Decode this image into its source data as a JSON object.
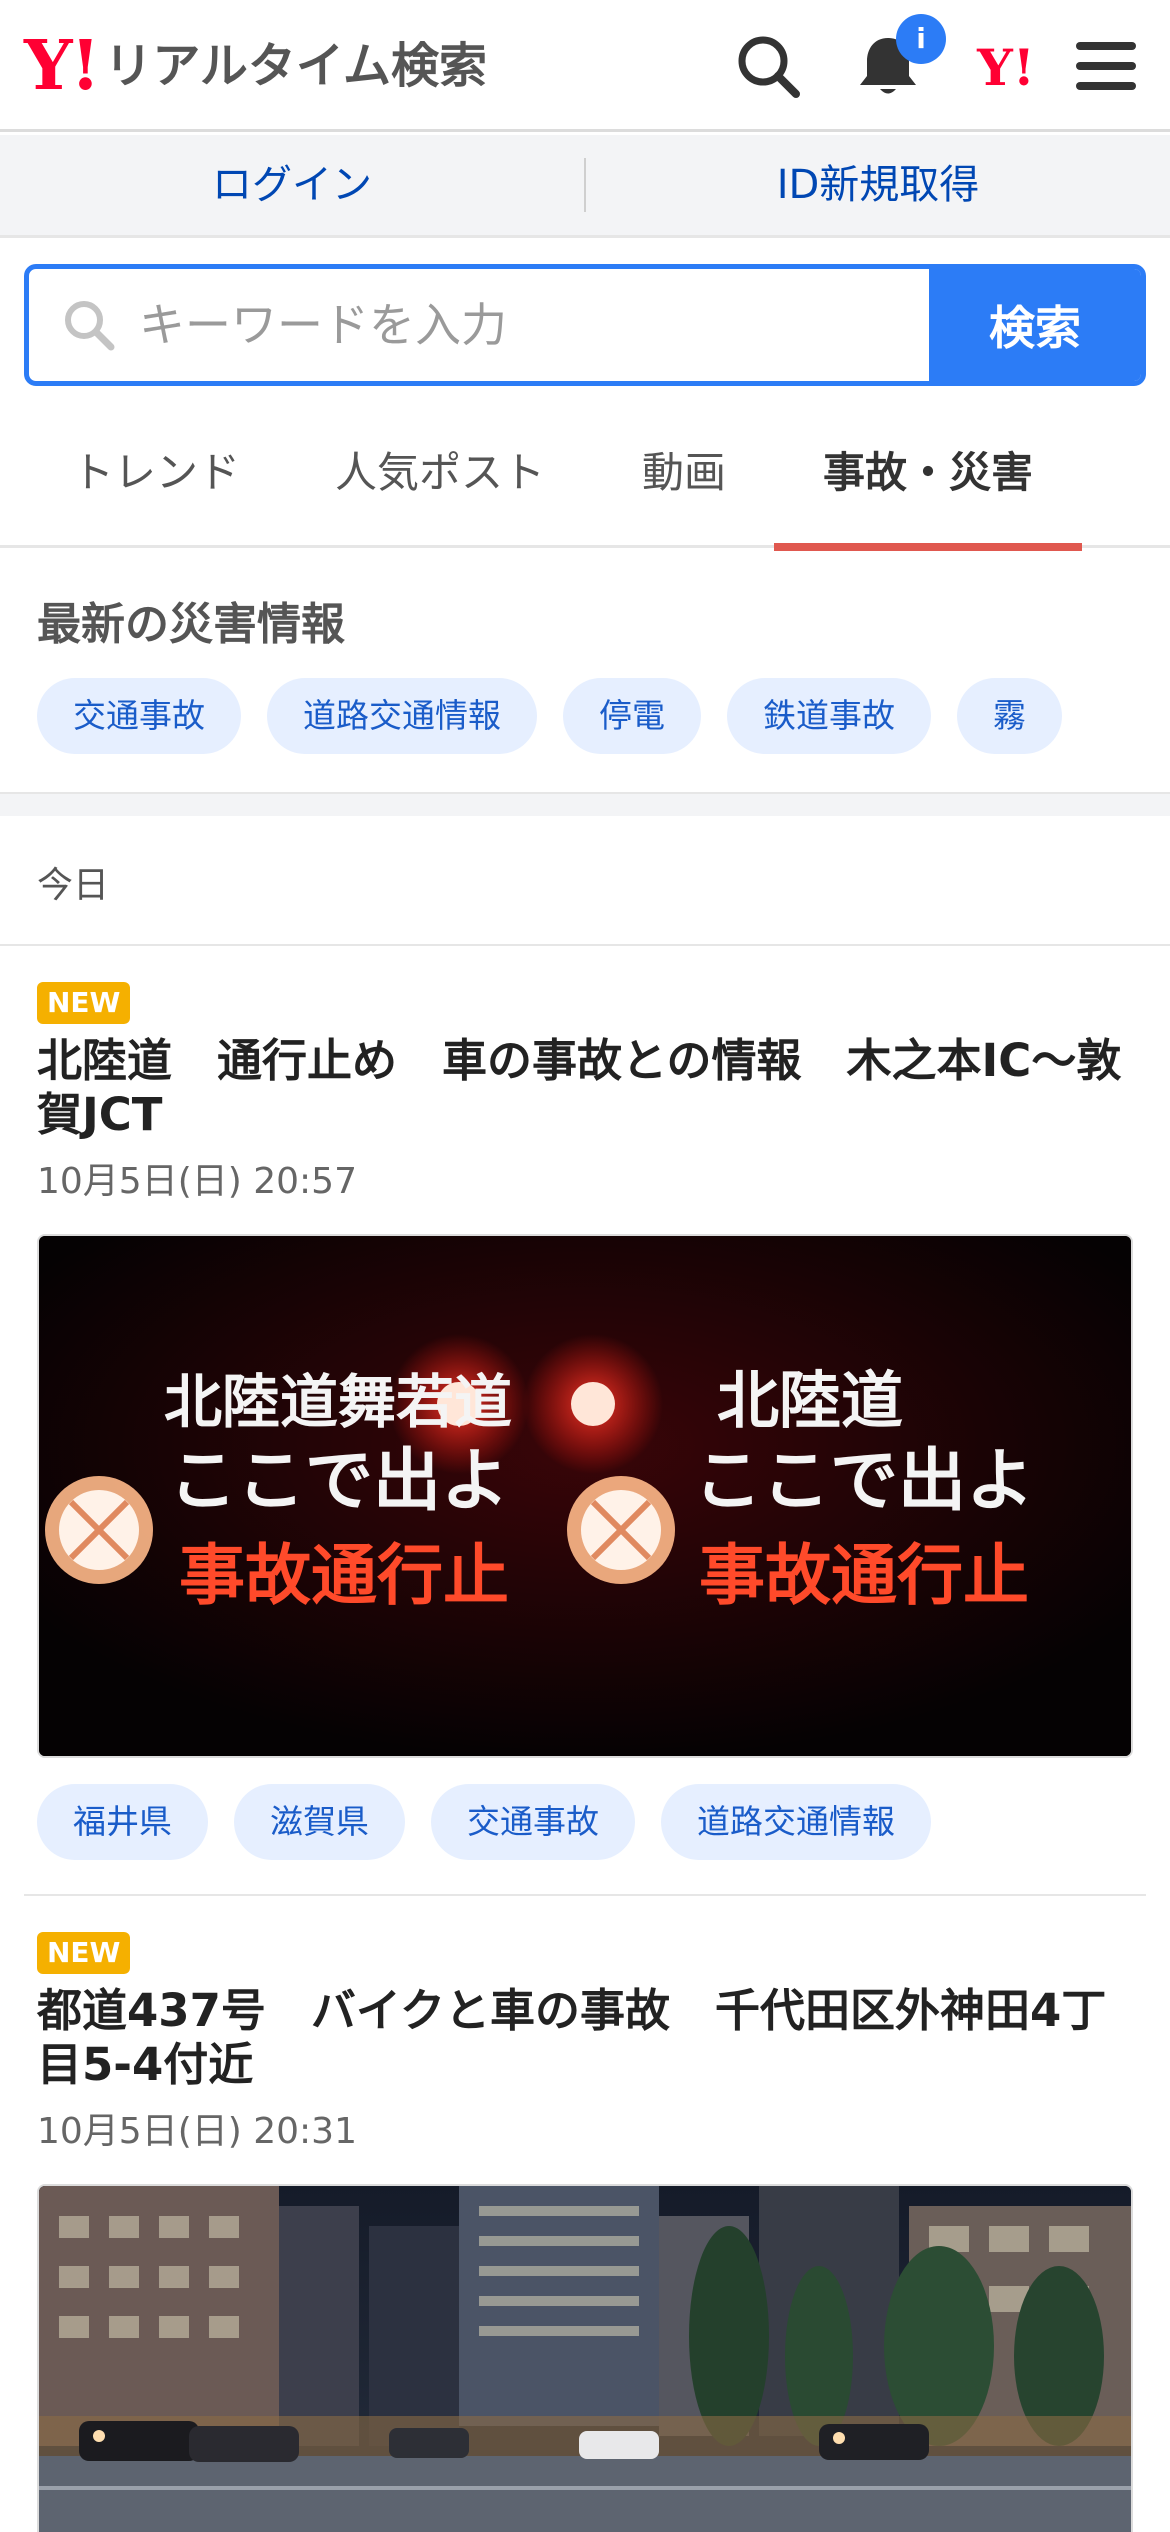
{
  "header": {
    "logo_mark": "Y!",
    "title": "リアルタイム検索",
    "notification_count": "i",
    "yahoo_link_label": "Y!"
  },
  "account": {
    "login_label": "ログイン",
    "register_label": "ID新規取得"
  },
  "search": {
    "placeholder": "キーワードを入力",
    "button_label": "検索"
  },
  "tabs": [
    {
      "label": "トレンド",
      "active": false
    },
    {
      "label": "人気ポスト",
      "active": false
    },
    {
      "label": "動画",
      "active": false
    },
    {
      "label": "事故・災害",
      "active": true
    }
  ],
  "disaster_section": {
    "title": "最新の災害情報",
    "chips": [
      "交通事故",
      "道路交通情報",
      "停電",
      "鉄道事故",
      "霧"
    ]
  },
  "date_group": {
    "label": "今日"
  },
  "articles": [
    {
      "badge": "NEW",
      "title": "北陸道　通行止め　車の事故との情報　木之本IC～敦賀JCT",
      "date": "10月5日(日) 20:57",
      "image_text": {
        "left_line1": "北陸道舞若道",
        "left_line2": "ここで出よ",
        "left_line3": "事故通行止",
        "right_line1": "北陸道",
        "right_line2": "ここで出よ",
        "right_line3": "事故通行止"
      },
      "tags": [
        "福井県",
        "滋賀県",
        "交通事故",
        "道路交通情報"
      ]
    },
    {
      "badge": "NEW",
      "title": "都道437号　バイクと車の事故　千代田区外神田4丁目5-4付近",
      "date": "10月5日(日) 20:31"
    }
  ],
  "colors": {
    "brand_red": "#ff0033",
    "accent_blue": "#2c7cf6",
    "chip_bg": "#e6efff",
    "chip_text": "#1a5cc9",
    "tab_underline": "#e0584f",
    "new_badge": "#f5b000"
  }
}
